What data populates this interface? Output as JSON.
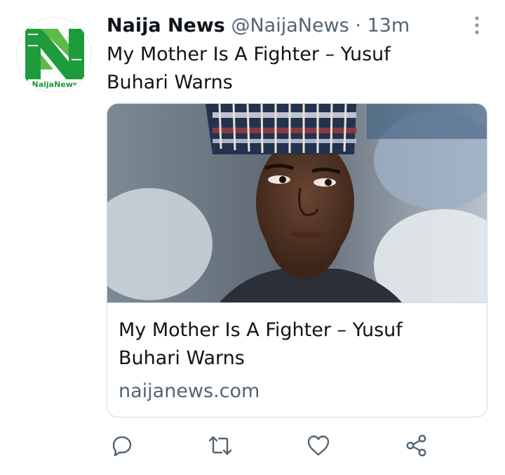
{
  "tweet": {
    "author_name": "Naija News",
    "handle": "@NaijaNews",
    "separator": "·",
    "time": "13m",
    "text": "My Mother Is A Fighter – Yusuf\nBuhari   Warns",
    "avatar_logo_text": "NaijaNews"
  },
  "card": {
    "title": "My Mother Is A Fighter – Yusuf Buhari Warns",
    "domain": "naijanews.com"
  },
  "icons": {
    "more": "more-vertical-icon",
    "reply": "reply-icon",
    "retweet": "retweet-icon",
    "like": "like-icon",
    "share": "share-icon"
  },
  "colors": {
    "text": "#0f1419",
    "secondary": "#536471",
    "border": "#cfd9de",
    "brand_green": "#1e9b3a"
  }
}
